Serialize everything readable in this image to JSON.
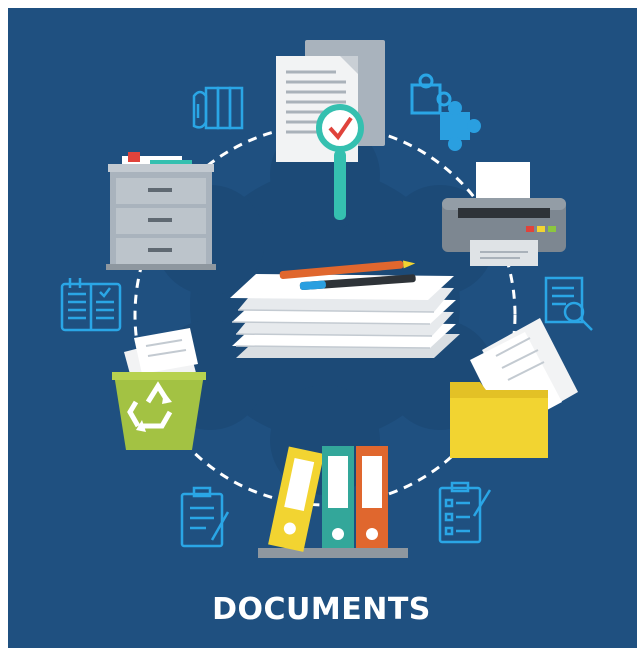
{
  "title": "DOCUMENTS",
  "colors": {
    "background": "#1f5080",
    "frame": "#ffffff",
    "ring_dash": "#ffffff",
    "line_icon": "#2aa6e6",
    "folder_yellow": "#f2d431",
    "recycle_bin_green": "#a3c243",
    "magnifier_teal": "#35c0b0",
    "check_red": "#e0433b",
    "binder_yellow": "#f2d431",
    "binder_teal": "#33a79a",
    "binder_orange": "#e0672e",
    "puzzle_blue": "#2a9fe0"
  },
  "illustrations": [
    "document-magnifier-icon",
    "puzzle-icon",
    "printer-icon",
    "search-document-icon",
    "folder-icon",
    "clipboard-checklist-icon",
    "binders-icon",
    "clipboard-icon",
    "recycle-bin-icon",
    "calendar-icon",
    "filing-cabinet-icon",
    "file-hand-icon",
    "paper-stack-icon"
  ]
}
